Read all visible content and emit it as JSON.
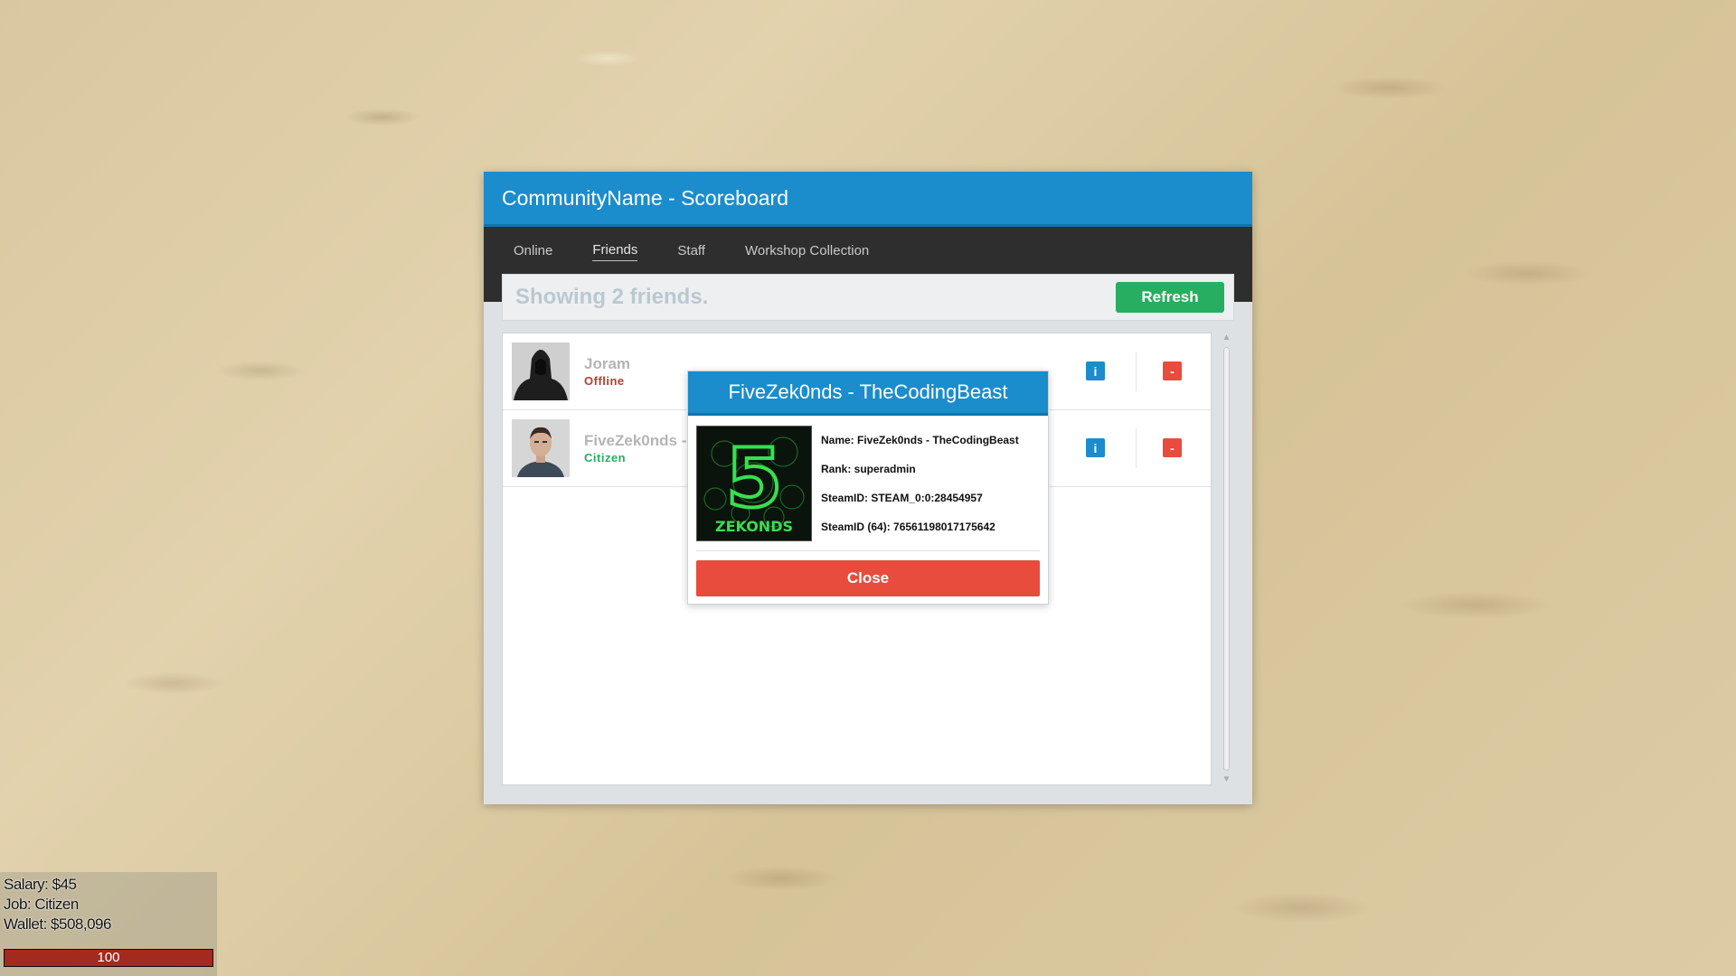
{
  "scoreboard": {
    "title": "CommunityName - Scoreboard",
    "tabs": [
      {
        "label": "Online"
      },
      {
        "label": "Friends",
        "active": true
      },
      {
        "label": "Staff"
      },
      {
        "label": "Workshop Collection"
      }
    ],
    "showing_text": "Showing 2 friends.",
    "refresh_label": "Refresh",
    "friends": [
      {
        "name": "Joram",
        "status": "Offline",
        "info_label": "i",
        "remove_label": "-"
      },
      {
        "name": "FiveZek0nds -",
        "status": "Citizen",
        "info_label": "i",
        "remove_label": "-"
      }
    ],
    "scroll_up": "▲",
    "scroll_down": "▼"
  },
  "popup": {
    "title": "FiveZek0nds - TheCodingBeast",
    "image_text": "ZEKONDS",
    "image_glyph": "5",
    "name_line": "Name: FiveZek0nds - TheCodingBeast",
    "rank_line": "Rank: superadmin",
    "steamid_line": "SteamID: STEAM_0:0:28454957",
    "steamid64_line": "SteamID (64): 76561198017175642",
    "close_label": "Close"
  },
  "hud": {
    "salary": "Salary: $45",
    "job": "Job: Citizen",
    "wallet": "Wallet: $508,096",
    "health": "100",
    "health_fraction": 1.0
  },
  "colors": {
    "primary": "#1b8ccc",
    "success": "#27ae60",
    "danger": "#e74c3c",
    "nav_bg": "#2e2e2e"
  }
}
